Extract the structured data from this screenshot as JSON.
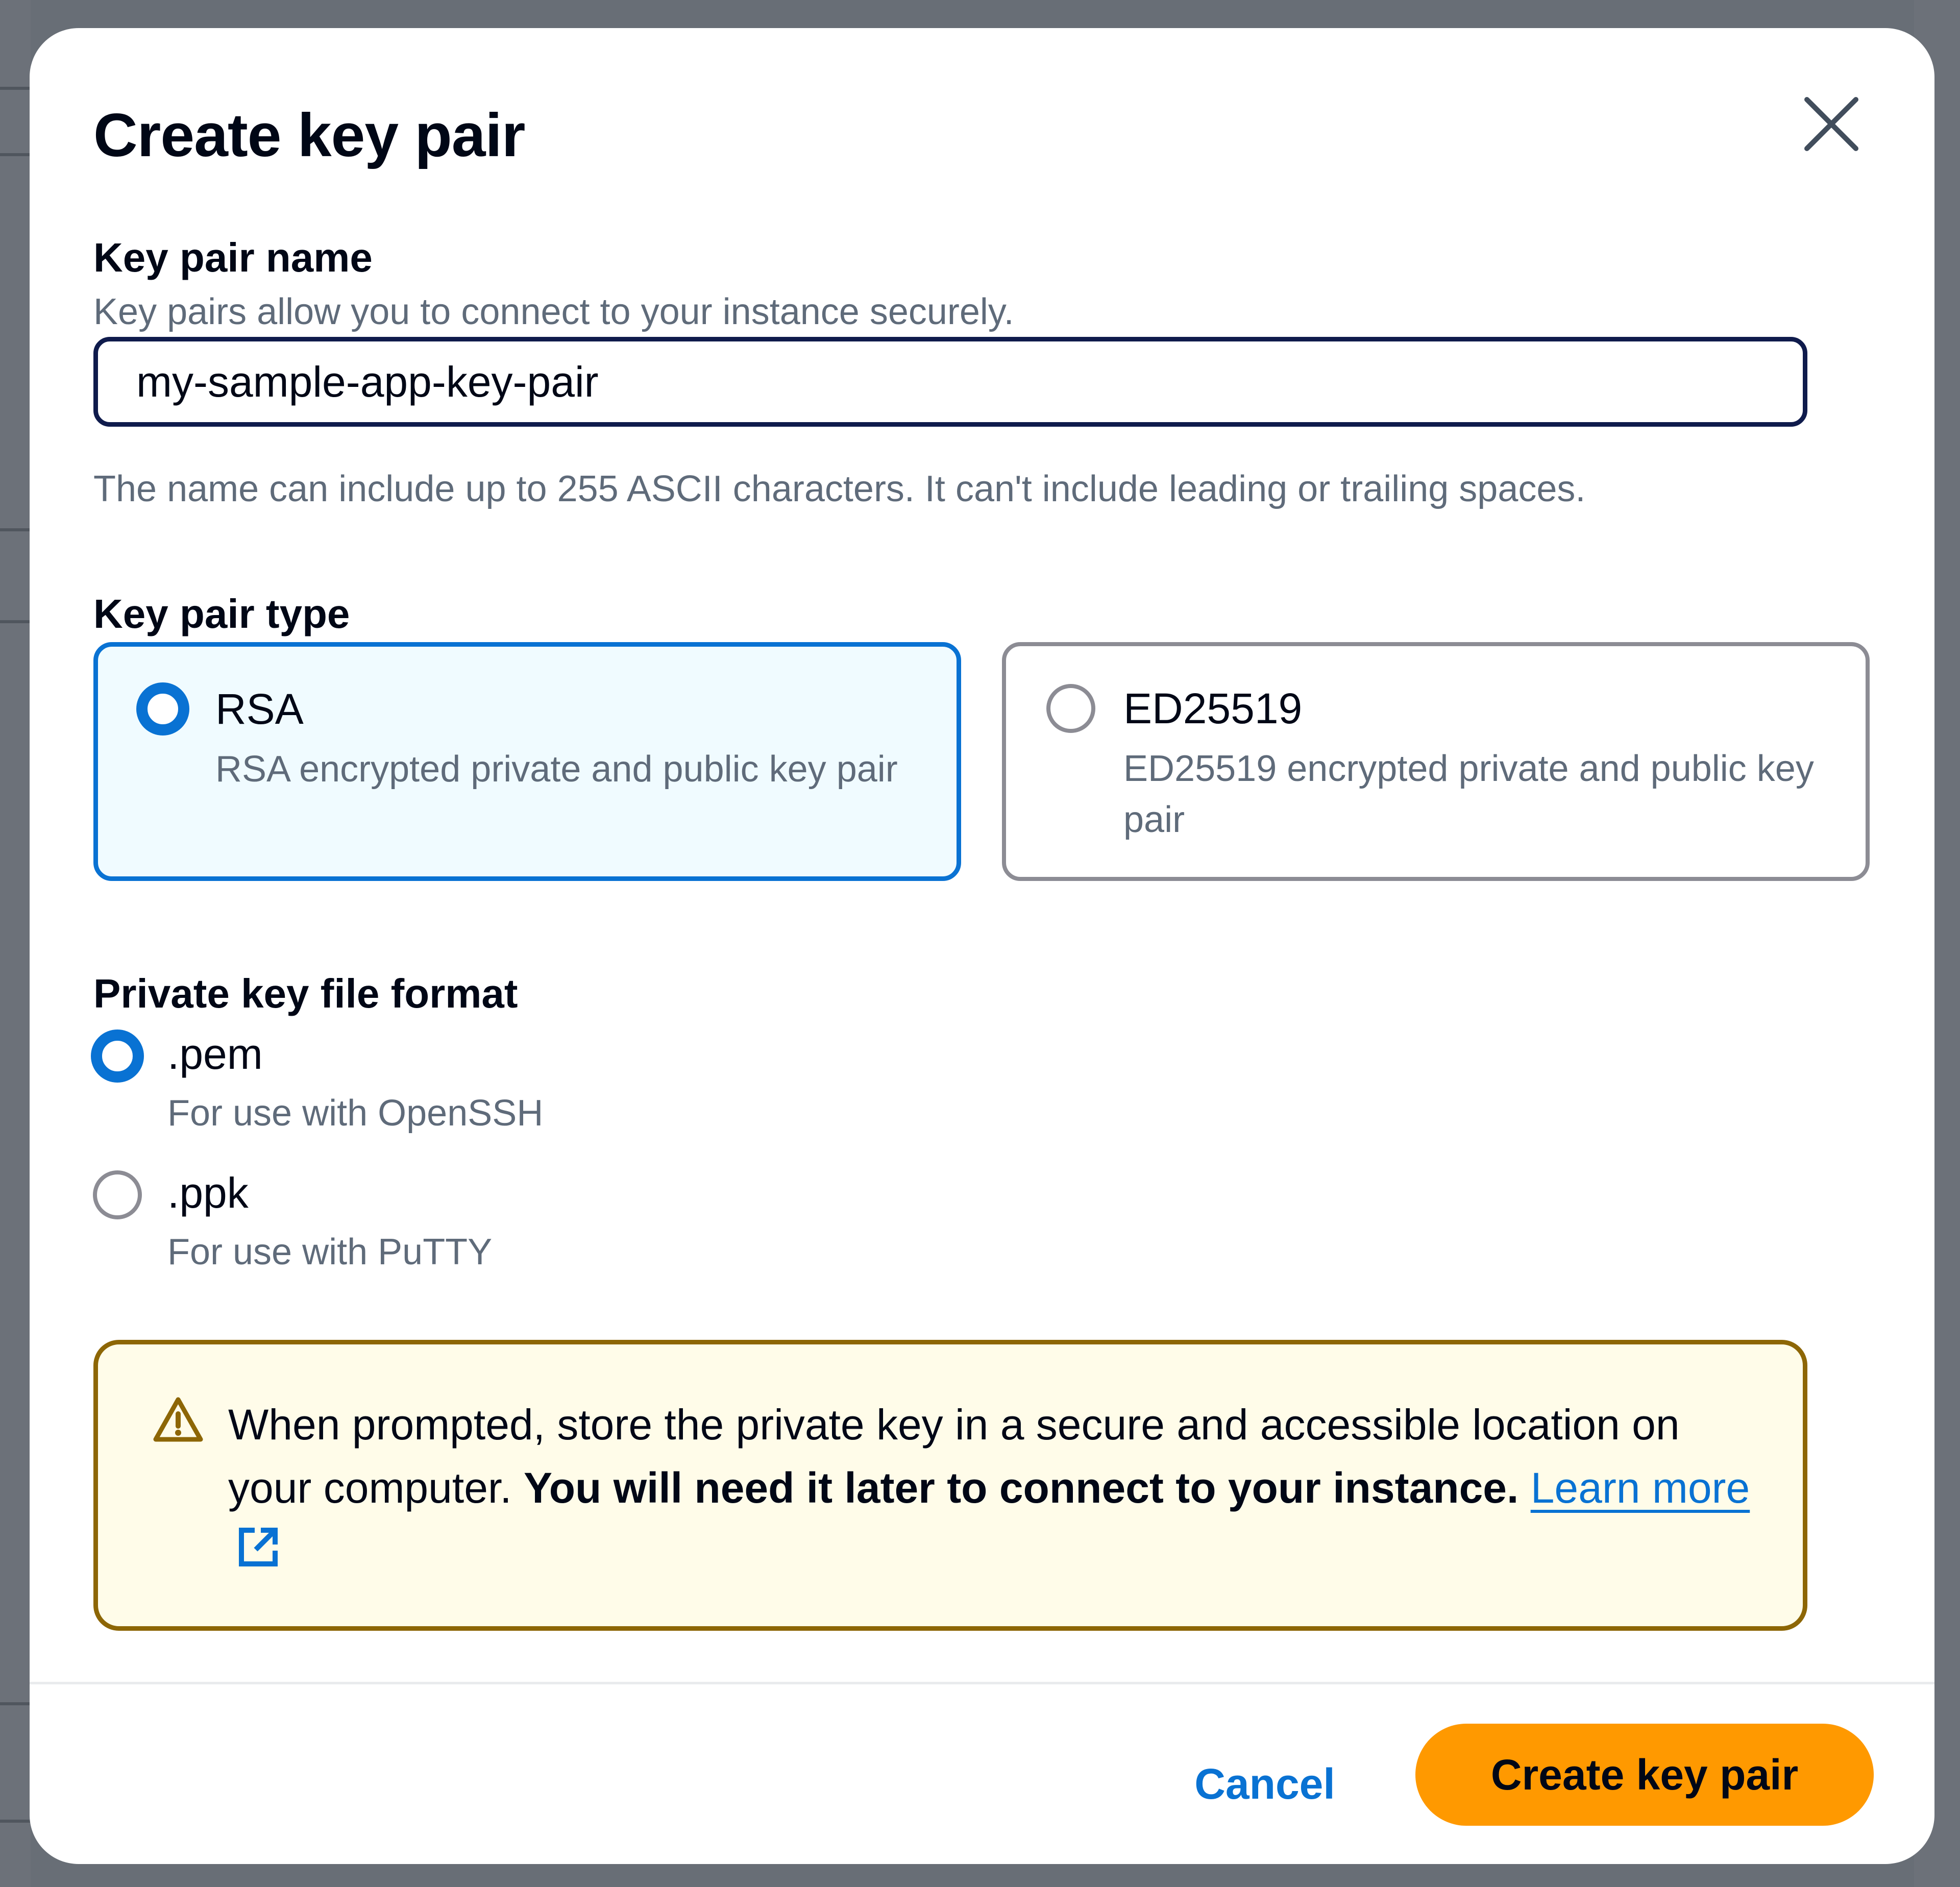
{
  "modal": {
    "title": "Create key pair"
  },
  "key_pair_name": {
    "label": "Key pair name",
    "description": "Key pairs allow you to connect to your instance securely.",
    "value": "my-sample-app-key-pair",
    "constraint": "The name can include up to 255 ASCII characters. It can't include leading or trailing spaces."
  },
  "key_pair_type": {
    "label": "Key pair type",
    "options": [
      {
        "title": "RSA",
        "description": "RSA encrypted private and public key pair",
        "selected": true
      },
      {
        "title": "ED25519",
        "description": "ED25519 encrypted private and public key pair",
        "selected": false
      }
    ]
  },
  "file_format": {
    "label": "Private key file format",
    "options": [
      {
        "label": ".pem",
        "description": "For use with OpenSSH",
        "selected": true
      },
      {
        "label": ".ppk",
        "description": "For use with PuTTY",
        "selected": false
      }
    ]
  },
  "alert": {
    "text_normal": "When prompted, store the private key in a secure and accessible location on your computer.",
    "text_bold": "You will need it later to connect to your instance.",
    "link_label": "Learn more"
  },
  "footer": {
    "cancel_label": "Cancel",
    "create_label": "Create key pair"
  },
  "colors": {
    "primary_blue": "#0972d3",
    "accent_orange": "#ff9900",
    "warning_border": "#8d6605",
    "warning_bg": "#fffce9",
    "text_dark": "#000716",
    "text_secondary": "#5f6b7a"
  }
}
